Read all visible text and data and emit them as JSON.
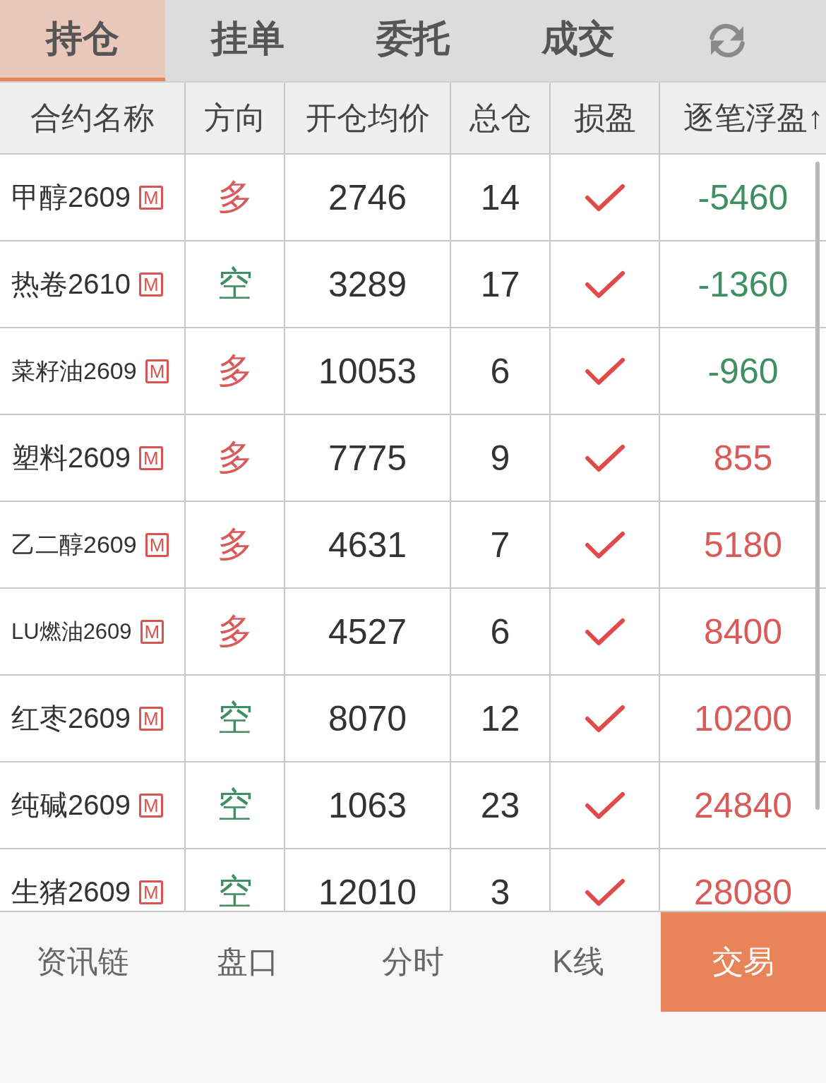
{
  "tabs": [
    {
      "label": "持仓",
      "selected": true
    },
    {
      "label": "挂单",
      "selected": false
    },
    {
      "label": "委托",
      "selected": false
    },
    {
      "label": "成交",
      "selected": false
    }
  ],
  "table": {
    "columns": [
      "合约名称",
      "方向",
      "开仓均价",
      "总仓",
      "损盈",
      "逐笔浮盈↑"
    ],
    "rows": [
      {
        "name": "甲醇2609",
        "badge": "M",
        "direction": "多",
        "long": true,
        "avg_price": "2746",
        "total": "14",
        "checked": true,
        "pnl": "-5460",
        "loss": true
      },
      {
        "name": "热卷2610",
        "badge": "M",
        "direction": "空",
        "long": false,
        "avg_price": "3289",
        "total": "17",
        "checked": true,
        "pnl": "-1360",
        "loss": true
      },
      {
        "name": "菜籽油2609",
        "badge": "M",
        "direction": "多",
        "long": true,
        "avg_price": "10053",
        "total": "6",
        "checked": true,
        "pnl": "-960",
        "loss": true
      },
      {
        "name": "塑料2609",
        "badge": "M",
        "direction": "多",
        "long": true,
        "avg_price": "7775",
        "total": "9",
        "checked": true,
        "pnl": "855",
        "loss": false
      },
      {
        "name": "乙二醇2609",
        "badge": "M",
        "direction": "多",
        "long": true,
        "avg_price": "4631",
        "total": "7",
        "checked": true,
        "pnl": "5180",
        "loss": false
      },
      {
        "name": "LU燃油2609",
        "badge": "M",
        "direction": "多",
        "long": true,
        "avg_price": "4527",
        "total": "6",
        "checked": true,
        "pnl": "8400",
        "loss": false
      },
      {
        "name": "红枣2609",
        "badge": "M",
        "direction": "空",
        "long": false,
        "avg_price": "8070",
        "total": "12",
        "checked": true,
        "pnl": "10200",
        "loss": false
      },
      {
        "name": "纯碱2609",
        "badge": "M",
        "direction": "空",
        "long": false,
        "avg_price": "1063",
        "total": "23",
        "checked": true,
        "pnl": "24840",
        "loss": false
      },
      {
        "name": "生猪2609",
        "badge": "M",
        "direction": "空",
        "long": false,
        "avg_price": "12010",
        "total": "3",
        "checked": true,
        "pnl": "28080",
        "loss": false
      }
    ]
  },
  "bottom_nav": [
    {
      "label": "资讯链",
      "selected": false
    },
    {
      "label": "盘口",
      "selected": false
    },
    {
      "label": "分时",
      "selected": false
    },
    {
      "label": "K线",
      "selected": false
    },
    {
      "label": "交易",
      "selected": true
    }
  ]
}
